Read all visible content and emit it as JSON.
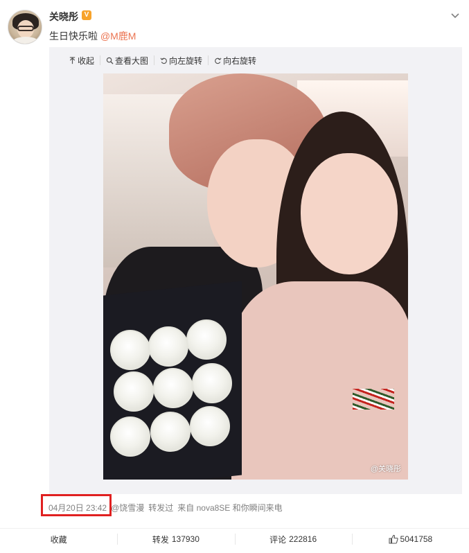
{
  "post": {
    "author": "关晓彤",
    "verified_badge": "V",
    "text": "生日快乐啦",
    "mention": "@M鹿M"
  },
  "toolbar": {
    "collapse": "收起",
    "view_large": "查看大图",
    "rotate_left": "向左旋转",
    "rotate_right": "向右旋转"
  },
  "photo": {
    "watermark": "@关晓彤"
  },
  "meta": {
    "time": "04月20日 23:42",
    "reposted_by": "@饶雪漫",
    "reposted_label": "转发过",
    "source": "来自 nova8SE 和你瞬间来电"
  },
  "actions": {
    "favorite": "收藏",
    "repost_label": "转发",
    "repost_count": "137930",
    "comment_label": "评论",
    "comment_count": "222816",
    "like_count": "5041758"
  },
  "colors": {
    "mention": "#eb7350",
    "highlight": "#e02020",
    "badge": "#f7a32b"
  }
}
